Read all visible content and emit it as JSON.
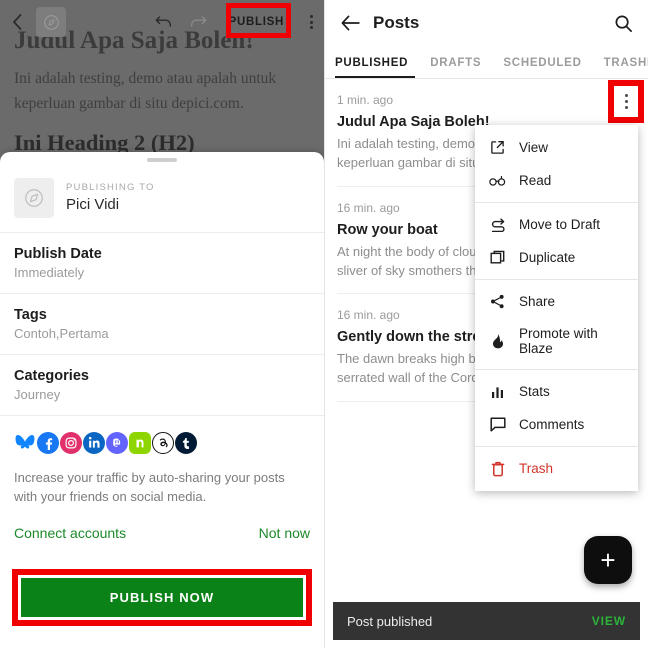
{
  "editor": {
    "toolbar": {
      "back_icon": "chevron-left-icon",
      "site_avatar_icon": "compass-icon",
      "undo_icon": "undo-arrow-icon",
      "redo_icon": "redo-arrow-icon",
      "publish_label": "PUBLISH",
      "more_icon": "kebab-menu-icon"
    },
    "content": {
      "heading1": "Judul Apa Saja Boleh!",
      "paragraph": "Ini adalah testing, demo atau apalah untuk keperluan gambar di situ depici.com.",
      "heading2": "Ini Heading 2 (H2)"
    }
  },
  "sheet": {
    "publishing_to": {
      "label": "PUBLISHING TO",
      "site_name": "Pici Vidi",
      "avatar_icon": "compass-icon"
    },
    "rows": [
      {
        "title": "Publish Date",
        "value": "Immediately"
      },
      {
        "title": "Tags",
        "value": "Contoh,Pertama"
      },
      {
        "title": "Categories",
        "value": "Journey"
      }
    ],
    "social": {
      "icons": [
        {
          "name": "bluesky-icon",
          "color": "#1185fe"
        },
        {
          "name": "facebook-icon",
          "color": "#1877f2"
        },
        {
          "name": "instagram-icon",
          "color": "#e1306c"
        },
        {
          "name": "linkedin-icon",
          "color": "#0a66c2"
        },
        {
          "name": "mastodon-icon",
          "color": "#6364ff"
        },
        {
          "name": "nextdoor-icon",
          "color": "#8ed500"
        },
        {
          "name": "threads-icon",
          "color": "#ffffff"
        },
        {
          "name": "tumblr-icon",
          "color": "#001935"
        }
      ],
      "description": "Increase your traffic by auto-sharing your posts with your friends on social media.",
      "connect_label": "Connect accounts",
      "not_now_label": "Not now"
    },
    "publish_now_label": "PUBLISH NOW"
  },
  "posts": {
    "appbar": {
      "back_icon": "arrow-left-icon",
      "title": "Posts",
      "search_icon": "search-icon"
    },
    "tabs": [
      {
        "label": "PUBLISHED",
        "active": true
      },
      {
        "label": "DRAFTS",
        "active": false
      },
      {
        "label": "SCHEDULED",
        "active": false
      },
      {
        "label": "TRASHED",
        "active": false
      }
    ],
    "items": [
      {
        "time": "1 min. ago",
        "title": "Judul Apa Saja Boleh!",
        "excerpt": "Ini adalah testing, demo atau apalah untuk keperluan gambar di situ depici.com."
      },
      {
        "time": "16 min. ago",
        "title": "Row your boat",
        "excerpt": "At night the body of clouds advances. Hardly a sliver of sky smothers the whole dark."
      },
      {
        "time": "16 min. ago",
        "title": "Gently down the stream",
        "excerpt": "The dawn breaks high behind the towering, serrated wall of the Cordillera."
      }
    ],
    "kebab_icon": "kebab-menu-icon",
    "fab_icon": "plus-icon"
  },
  "context_menu": {
    "groups": [
      [
        {
          "label": "View",
          "icon": "external-link-icon",
          "danger": false
        },
        {
          "label": "Read",
          "icon": "glasses-icon",
          "danger": false
        }
      ],
      [
        {
          "label": "Move to Draft",
          "icon": "move-to-draft-icon",
          "danger": false
        },
        {
          "label": "Duplicate",
          "icon": "duplicate-icon",
          "danger": false
        }
      ],
      [
        {
          "label": "Share",
          "icon": "share-icon",
          "danger": false
        },
        {
          "label": "Promote with Blaze",
          "icon": "flame-icon",
          "danger": false
        }
      ],
      [
        {
          "label": "Stats",
          "icon": "bar-chart-icon",
          "danger": false
        },
        {
          "label": "Comments",
          "icon": "comment-bubble-icon",
          "danger": false
        }
      ],
      [
        {
          "label": "Trash",
          "icon": "trash-icon",
          "danger": true
        }
      ]
    ]
  },
  "snackbar": {
    "message": "Post published",
    "action_label": "VIEW"
  },
  "colors": {
    "publish_green": "#0a8217",
    "link_green": "#1c8a2a",
    "snackbar_action_green": "#2bb33a",
    "highlight_red": "#f00000",
    "trash_red": "#d1352b"
  }
}
